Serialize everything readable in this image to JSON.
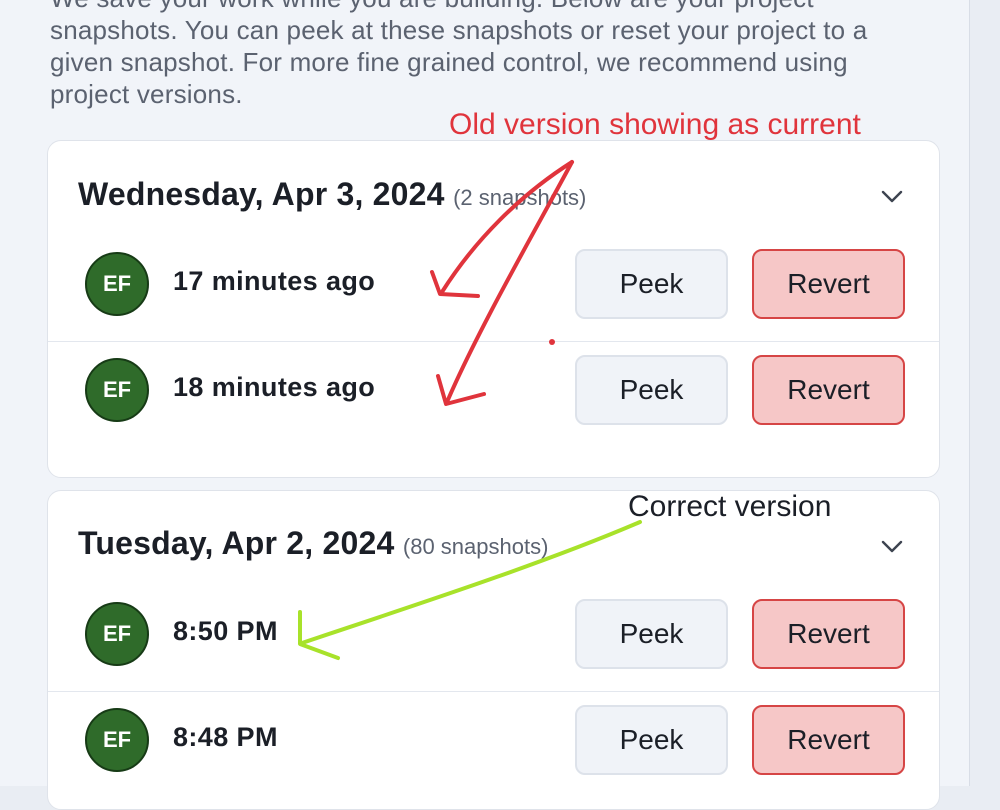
{
  "intro_text": "We save your work while you are building. Below are your project snapshots. You can peek at these snapshots or reset your project to a given snapshot. For more fine grained control, we recommend using project versions.",
  "days": [
    {
      "title": "Wednesday, Apr 3, 2024",
      "count": "(2 snapshots)",
      "snapshots": [
        {
          "avatar": "EF",
          "time": "17 minutes ago",
          "peek_label": "Peek",
          "revert_label": "Revert"
        },
        {
          "avatar": "EF",
          "time": "18 minutes ago",
          "peek_label": "Peek",
          "revert_label": "Revert"
        }
      ]
    },
    {
      "title": "Tuesday, Apr 2, 2024",
      "count": "(80 snapshots)",
      "snapshots": [
        {
          "avatar": "EF",
          "time": "8:50 PM",
          "peek_label": "Peek",
          "revert_label": "Revert"
        },
        {
          "avatar": "EF",
          "time": "8:48 PM",
          "peek_label": "Peek",
          "revert_label": "Revert"
        }
      ]
    }
  ],
  "annotations": {
    "old_version": "Old version showing as current",
    "correct_version": "Correct version"
  },
  "icons": {
    "collapse": "chevron-down-icon"
  },
  "colors": {
    "avatar_bg": "#2f6b2a",
    "revert_bg": "#f6c7c7",
    "revert_border": "#d64545",
    "annotation_red": "#e0343c",
    "annotation_green": "#a8e22a"
  }
}
